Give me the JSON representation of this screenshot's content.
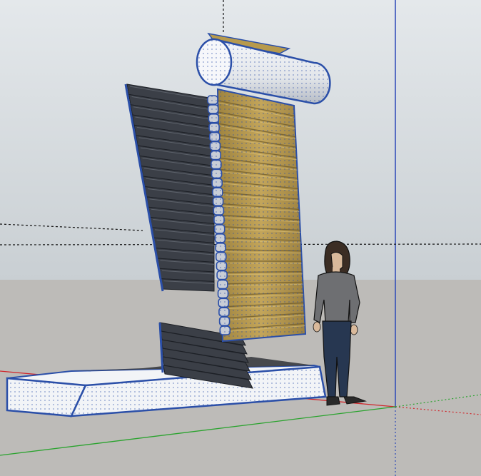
{
  "viewport": {
    "sky_color_top": "#e4e8eb",
    "sky_color_bottom": "#c9cfd3",
    "ground_color": "#bdbbb8",
    "axis_colors": {
      "red": "#d0262b",
      "green": "#2aa32e",
      "blue": "#2b47b8",
      "inference_black": "#111111"
    }
  },
  "model": {
    "edge_color": "#2b4fa8",
    "base_face_color": "#f2f4f7",
    "base_shadow_color": "#3f4146",
    "dark_slats_color": "#3b3f47",
    "gold_slats_color": "#b79a4d",
    "cylinder_color": "#f4f6f9",
    "cylinder_shade_color": "#a8adb6"
  },
  "figure": {
    "hair_color": "#3b2d24",
    "skin_color": "#d9b99b",
    "sweater_color": "#6e6f72",
    "jeans_color": "#273751",
    "shoes_color": "#2a2a2a"
  }
}
